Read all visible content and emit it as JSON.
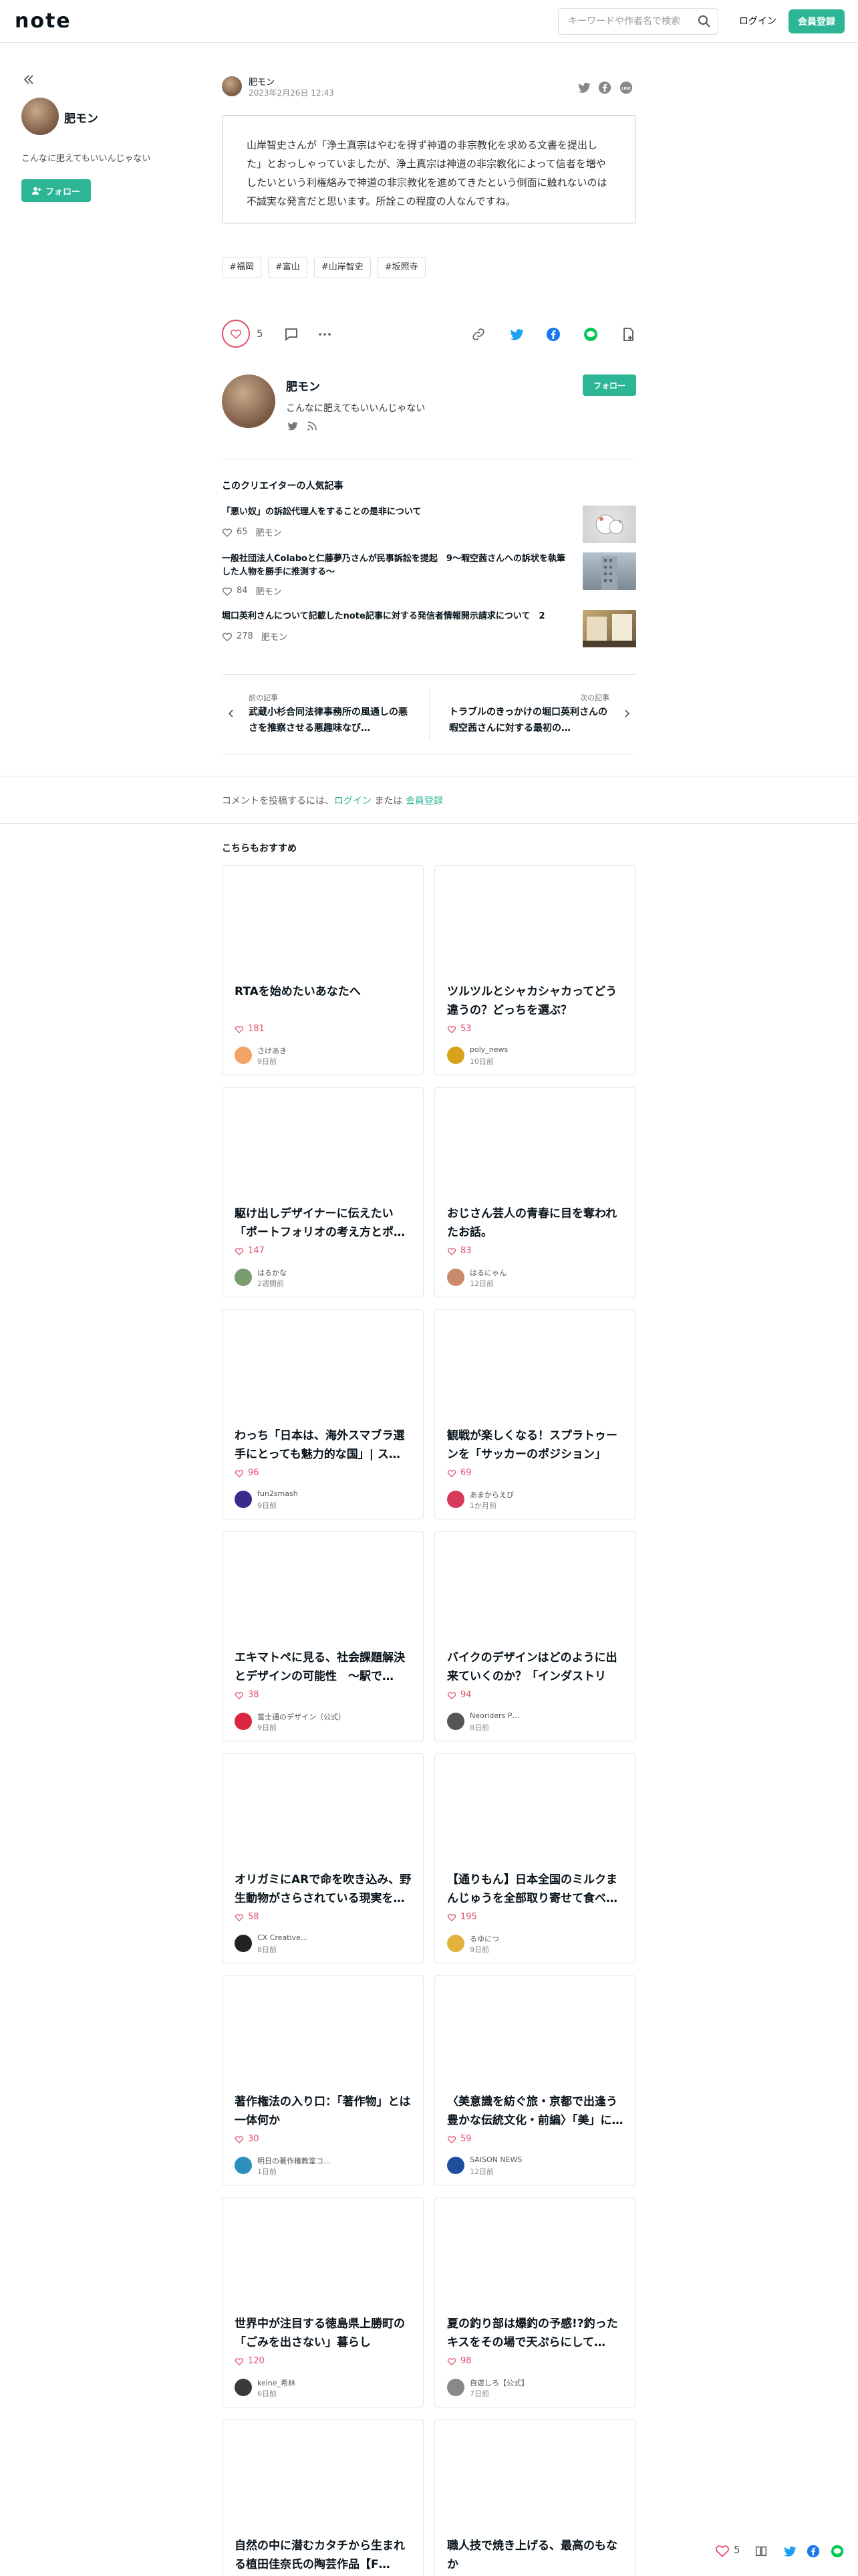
{
  "header": {
    "logo": "note",
    "search_placeholder": "キーワードや作者名で検索",
    "login": "ログイン",
    "register": "会員登録"
  },
  "sidebar": {
    "name": "肥モン",
    "bio": "こんなに肥えてもいいんじゃない",
    "follow": "フォロー"
  },
  "post": {
    "author": "肥モン",
    "date": "2023年2月26日 12:43",
    "quote": "山岸智史さんが「浄土真宗はやむを得ず神道の非宗教化を求める文書を提出した」とおっしゃっていましたが、浄土真宗は神道の非宗教化によって信者を増やしたいという利権絡みで神道の非宗教化を進めてきたという側面に触れないのは不誠実な発言だと思います。所詮この程度の人なんですね。",
    "tags": [
      "#福岡",
      "#富山",
      "#山岸智史",
      "#坂照寺"
    ],
    "like_count": "5"
  },
  "creator": {
    "name": "肥モン",
    "bio": "こんなに肥えてもいいんじゃない",
    "follow": "フォロー"
  },
  "popular": {
    "title": "このクリエイターの人気記事",
    "items": [
      {
        "title": "「悪い奴」の訴訟代理人をすることの是非について",
        "likes": "65",
        "author": "肥モン"
      },
      {
        "title": "一般社団法人Colaboと仁藤夢乃さんが民事訴訟を提起　9～暇空茜さんへの訴状を執筆した人物を勝手に推測する～",
        "likes": "84",
        "author": "肥モン"
      },
      {
        "title": "堀口英利さんについて記載したnote記事に対する発信者情報開示請求について　2",
        "likes": "278",
        "author": "肥モン"
      }
    ]
  },
  "pager": {
    "prev_label": "前の記事",
    "prev_title": "武蔵小杉合同法律事務所の風通しの悪さを推察させる悪趣味なび…",
    "next_label": "次の記事",
    "next_title": "トラブルのきっかけの堀口英利さんの暇空茜さんに対する最初の…"
  },
  "comment": {
    "prefix": "コメントを投稿するには、",
    "login": "ログイン",
    "middle": " または ",
    "register": "会員登録"
  },
  "recommend": {
    "title": "こちらもおすすめ",
    "cards": [
      {
        "title": "RTAを始めたいあなたへ",
        "likes": "181",
        "author": "さけあき",
        "time": "9日前",
        "avatar_color": "#f2a365"
      },
      {
        "title": "ツルツルとシャカシャカってどう違うの？どっちを選ぶ？",
        "likes": "53",
        "author": "poly_news",
        "time": "10日前",
        "avatar_color": "#d9a21b"
      },
      {
        "title": "駆け出しデザイナーに伝えたい「ポートフォリオの考え方とポ…",
        "likes": "147",
        "author": "はるかな",
        "time": "2週間前",
        "avatar_color": "#7a9c6e"
      },
      {
        "title": "おじさん芸人の青春に目を奪われたお話。",
        "likes": "83",
        "author": "はるにゃん",
        "time": "12日前",
        "avatar_color": "#c98b6b"
      },
      {
        "title": "わっち「日本は、海外スマブラ選手にとっても魅力的な国」| ス…",
        "likes": "96",
        "author": "fun2smash",
        "time": "9日前",
        "avatar_color": "#3b2a8c"
      },
      {
        "title": "観戦が楽しくなる！スプラトゥーンを「サッカーのポジション」か…",
        "likes": "69",
        "author": "あまからえび",
        "time": "1か月前",
        "avatar_color": "#d83a5a"
      },
      {
        "title": "エキマトペに見る、社会課題解決とデザインの可能性　〜駅で…",
        "likes": "38",
        "author": "富士通のデザイン（公式）",
        "time": "9日前",
        "avatar_color": "#d7263d"
      },
      {
        "title": "バイクのデザインはどのように出来ていくのか？「インダストリア…",
        "likes": "94",
        "author": "Neoriders P…",
        "time": "8日前",
        "avatar_color": "#555555"
      },
      {
        "title": "オリガミにARで命を吹き込み、野生動物がさらされている現実を…",
        "likes": "58",
        "author": "CX Creative…",
        "time": "8日前",
        "avatar_color": "#222222"
      },
      {
        "title": "【通りもん】日本全国のミルクまんじゅうを全部取り寄せて食べ…",
        "likes": "195",
        "author": "るゆにつ",
        "time": "9日前",
        "avatar_color": "#e3b23c"
      },
      {
        "title": "著作権法の入り口：「著作物」とは一体何か",
        "likes": "30",
        "author": "明日の著作権教室コ…",
        "time": "1日前",
        "avatar_color": "#2a8fbd"
      },
      {
        "title": "〈美意識を紡ぐ旅・京都で出逢う豊かな伝統文化・前編〉「美」に…",
        "likes": "59",
        "author": "SAISON NEWS",
        "time": "12日前",
        "avatar_color": "#1f4e9c"
      },
      {
        "title": "世界中が注目する徳島県上勝町の「ごみを出さない」暮らし",
        "likes": "120",
        "author": "keine_希林",
        "time": "6日前",
        "avatar_color": "#3a3a3a"
      },
      {
        "title": "夏の釣り部は爆釣の予感!?釣ったキスをその場で天ぷらにして…",
        "likes": "98",
        "author": "自遊しろ【公式】",
        "time": "7日前",
        "avatar_color": "#888888"
      },
      {
        "title": "自然の中に潜むカタチから生まれる植田佳奈氏の陶芸作品【F…",
        "likes": "",
        "author": "",
        "time": "",
        "avatar_color": "#cccccc"
      },
      {
        "title": "職人技で焼き上げる、最高のもなか",
        "likes": "",
        "author": "",
        "time": "",
        "avatar_color": "#cccccc"
      }
    ]
  },
  "float_bar": {
    "like_count": "5"
  },
  "colors": {
    "accent": "#2cb696",
    "like": "#e34f6a",
    "text": "#08131a"
  }
}
